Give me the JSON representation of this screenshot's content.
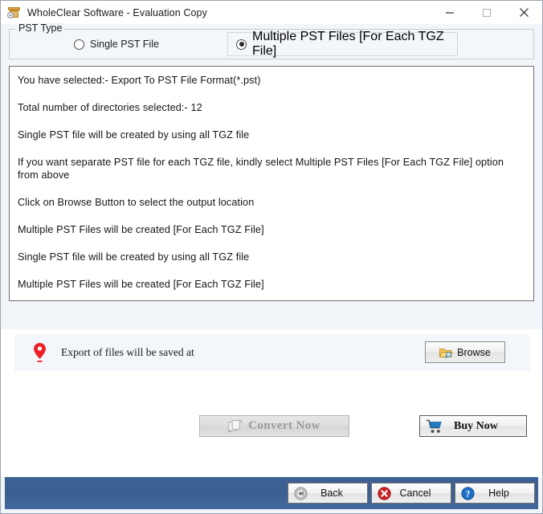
{
  "window": {
    "title": "WholeClear Software - Evaluation Copy",
    "app_icon": "archive-box-icon",
    "controls": [
      {
        "name": "minimize-button",
        "glyph": "minimize-icon"
      },
      {
        "name": "maximize-button",
        "glyph": "maximize-icon"
      },
      {
        "name": "close-button",
        "glyph": "close-icon"
      }
    ]
  },
  "pst_type": {
    "legend": "PST Type",
    "options": [
      {
        "label": "Single PST File",
        "selected": false
      },
      {
        "label": "Multiple PST Files [For Each TGZ File]",
        "selected": true
      }
    ]
  },
  "info": {
    "lines": [
      "You have selected:- Export To PST File Format(*.pst)",
      "Total number of directories selected:- 12",
      "Single PST file will be created by using all TGZ file",
      "If you want separate PST file for each TGZ file, kindly select Multiple PST Files [For Each TGZ File] option from above",
      "Click on Browse Button to select the output location",
      "Multiple PST Files will be created [For Each TGZ File]",
      "Single PST file will be created by using all TGZ file",
      "Multiple PST Files will be created [For Each TGZ File]"
    ]
  },
  "save_location": {
    "icon": "map-pin-icon",
    "label": "Export of files will be saved at",
    "browse_label": "Browse",
    "browse_icon": "folder-search-icon"
  },
  "actions": {
    "convert_label": "Convert Now",
    "convert_icon": "convert-documents-icon",
    "convert_enabled": false,
    "buy_label": "Buy Now",
    "buy_icon": "shopping-cart-icon"
  },
  "footer": {
    "buttons": [
      {
        "label": "Back",
        "icon": "rewind-icon"
      },
      {
        "label": "Cancel",
        "icon": "cancel-x-icon"
      },
      {
        "label": "Help",
        "icon": "help-question-icon"
      }
    ]
  },
  "colors": {
    "footer_blue": "#3e6194",
    "pin_red": "#ec2027",
    "cart_blue": "#1e7dc4",
    "cancel_red": "#cf2027",
    "help_blue": "#1d70c8",
    "folder_yellow": "#f0c248",
    "window_bg": "#f2f5f9"
  }
}
